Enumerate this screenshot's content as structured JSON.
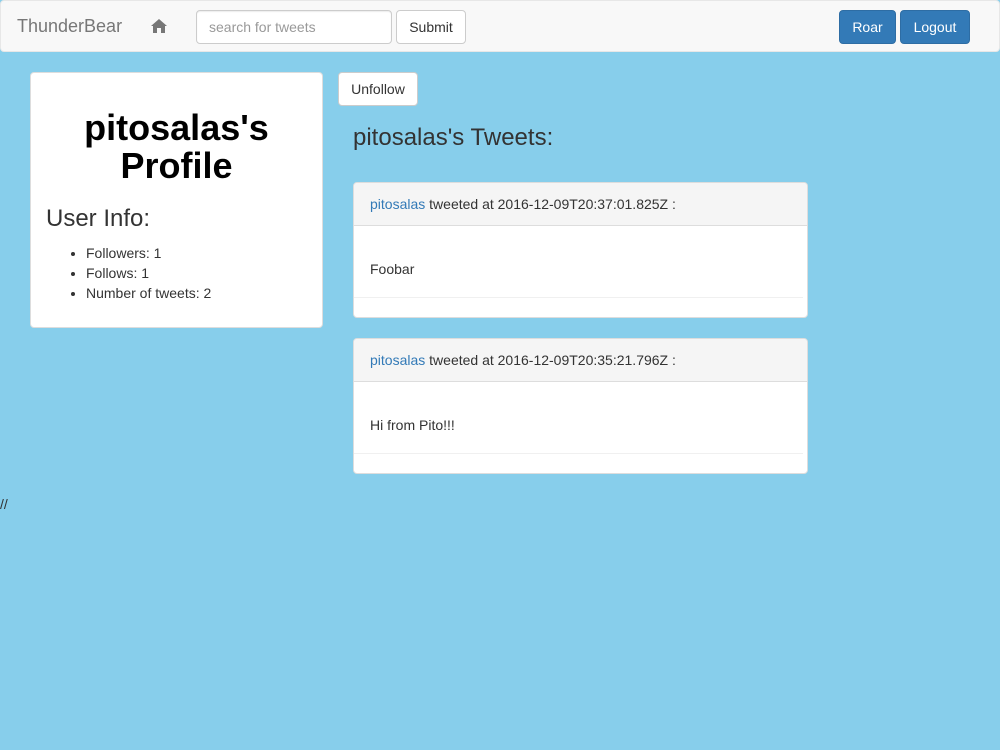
{
  "navbar": {
    "brand": "ThunderBear",
    "home_icon": "home-icon",
    "search_placeholder": "search for tweets",
    "search_value": "",
    "submit_label": "Submit",
    "roar_label": "Roar",
    "logout_label": "Logout"
  },
  "profile": {
    "title_line1": "pitosalas's",
    "title_line2": "Profile",
    "user_info_heading": "User Info:",
    "stats": [
      "Followers: 1",
      "Follows: 1",
      "Number of tweets: 2"
    ]
  },
  "unfollow_label": "Unfollow",
  "tweets_heading": "pitosalas's Tweets:",
  "tweets": [
    {
      "author": "pitosalas",
      "meta": " tweeted at 2016-12-09T20:37:01.825Z :",
      "text": "Foobar"
    },
    {
      "author": "pitosalas",
      "meta": " tweeted at 2016-12-09T20:35:21.796Z :",
      "text": "Hi from Pito!!!"
    }
  ],
  "stray_text": "//",
  "colors": {
    "page_background": "#87ceeb",
    "primary": "#337ab7",
    "link": "#337ab7"
  }
}
